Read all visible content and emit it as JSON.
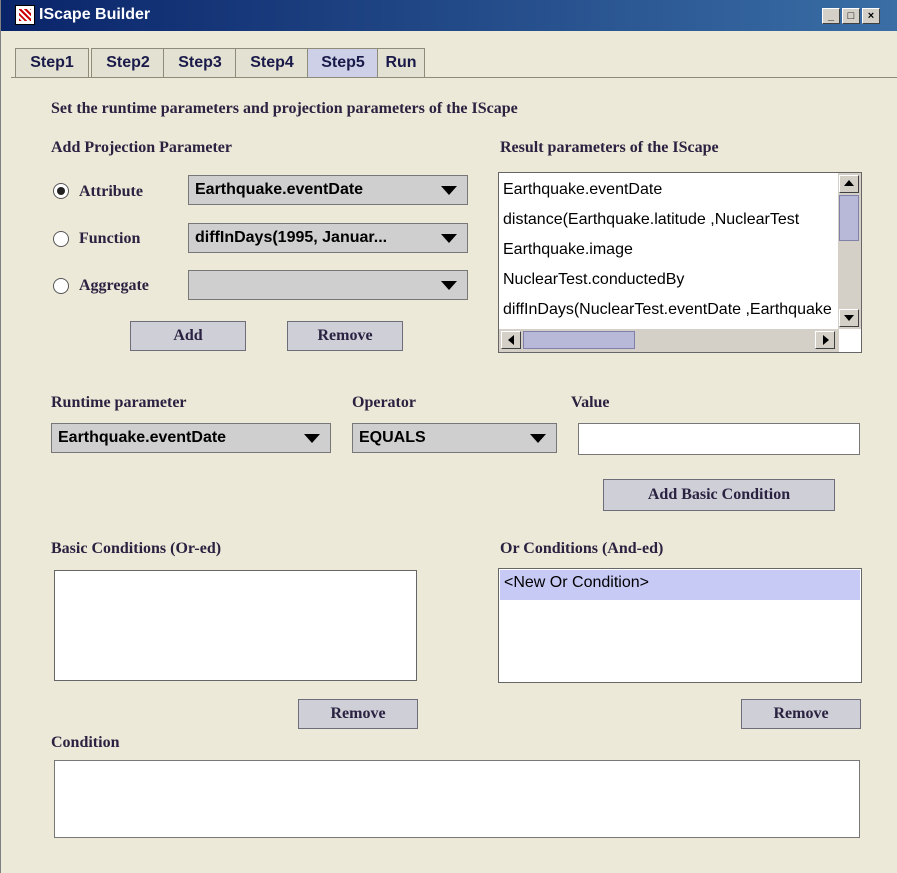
{
  "window": {
    "title": "IScape Builder"
  },
  "tabs": [
    "Step1",
    "Step2",
    "Step3",
    "Step4",
    "Step5",
    "Run"
  ],
  "active_tab": "Step5",
  "header": "Set the runtime parameters and projection parameters of the IScape",
  "projection": {
    "label": "Add Projection Parameter",
    "attribute_label": "Attribute",
    "function_label": "Function",
    "aggregate_label": "Aggregate",
    "attribute_value": "Earthquake.eventDate",
    "function_value": "diffInDays(1995, Januar...",
    "aggregate_value": "",
    "selected": "Attribute",
    "add_label": "Add",
    "remove_label": "Remove"
  },
  "results": {
    "label": "Result parameters of the IScape",
    "items": [
      "Earthquake.eventDate",
      "distance(Earthquake.latitude ,NuclearTest",
      "Earthquake.image",
      "NuclearTest.conductedBy",
      "diffInDays(NuclearTest.eventDate ,Earthquake"
    ]
  },
  "runtime": {
    "param_label": "Runtime parameter",
    "param_value": "Earthquake.eventDate",
    "operator_label": "Operator",
    "operator_value": "EQUALS",
    "value_label": "Value",
    "value": "",
    "add_basic_label": "Add Basic Condition"
  },
  "basic_conditions": {
    "label": "Basic Conditions (Or-ed)",
    "items": [],
    "remove_label": "Remove"
  },
  "or_conditions": {
    "label": "Or Conditions (And-ed)",
    "items": [
      "<New Or Condition>"
    ],
    "remove_label": "Remove"
  },
  "condition": {
    "label": "Condition",
    "value": ""
  },
  "colors": {
    "title_bar": "#0a246a",
    "background": "#ece9d8",
    "selection": "#c8caf6"
  }
}
